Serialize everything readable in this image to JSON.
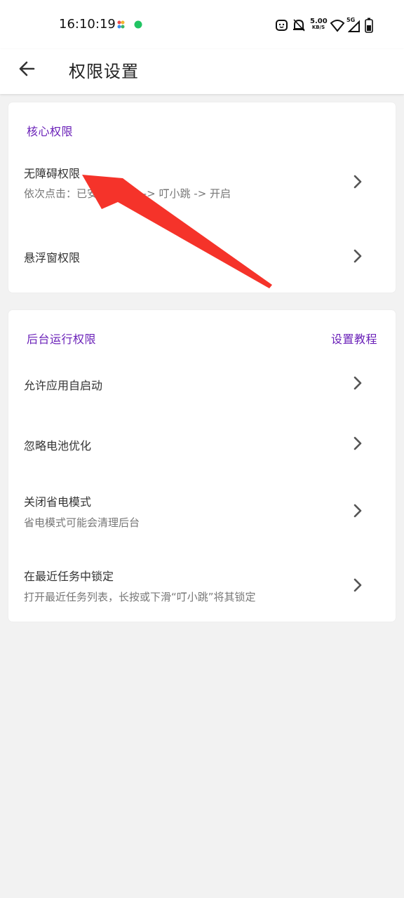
{
  "status_bar": {
    "time": "16:10:19",
    "net_speed_value": "5.00",
    "net_speed_unit": "KB/S",
    "network_type": "5G",
    "icons": [
      "app-icon",
      "wechat-icon",
      "face-icon",
      "bell-off-icon",
      "wifi-icon",
      "signal-icon",
      "battery-icon"
    ]
  },
  "header": {
    "title": "权限设置",
    "back_icon": "arrow-left-icon"
  },
  "core_permissions": {
    "section_title": "核心权限",
    "items": [
      {
        "title": "无障碍权限",
        "subtitle": "依次点击：已安装的服务 -> 叮小跳 -> 开启"
      },
      {
        "title": "悬浮窗权限",
        "subtitle": ""
      }
    ]
  },
  "background_permissions": {
    "section_title": "后台运行权限",
    "tutorial_link": "设置教程",
    "items": [
      {
        "title": "允许应用自启动",
        "subtitle": ""
      },
      {
        "title": "忽略电池优化",
        "subtitle": ""
      },
      {
        "title": "关闭省电模式",
        "subtitle": "省电模式可能会清理后台"
      },
      {
        "title": "在最近任务中锁定",
        "subtitle": "打开最近任务列表，长按或下滑“叮小跳”将其锁定"
      }
    ]
  },
  "colors": {
    "accent": "#6a20b8",
    "annotation_arrow": "#f5332a",
    "background": "#f2f2f2"
  }
}
